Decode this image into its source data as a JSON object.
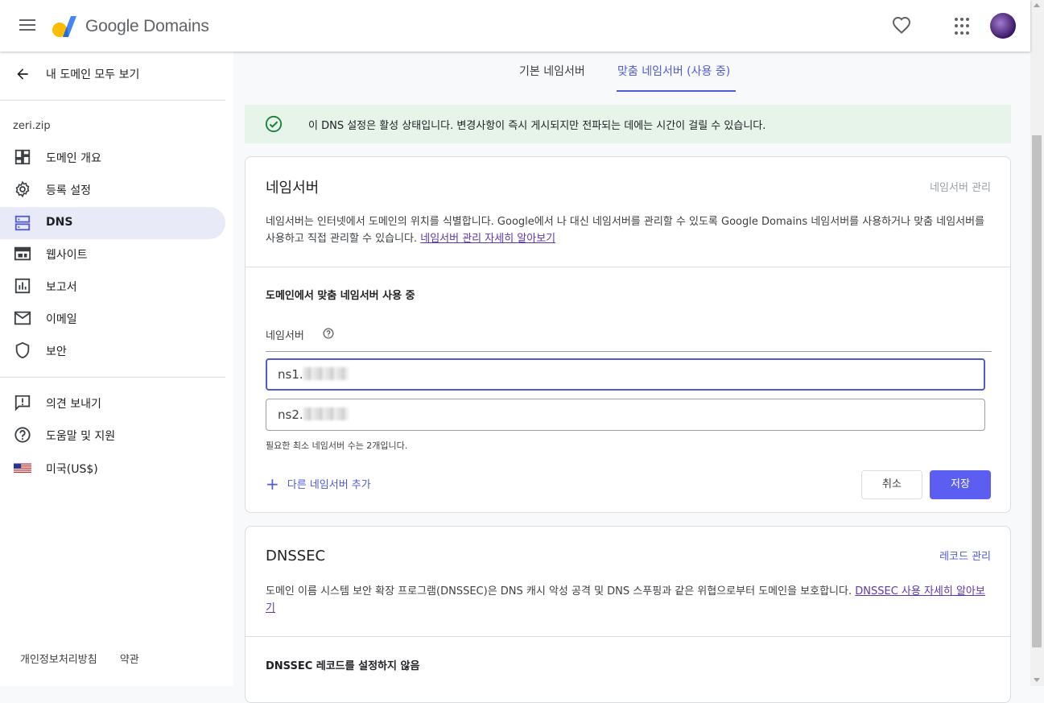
{
  "header": {
    "logo_text": "Google Domains",
    "icons": [
      "menu-icon",
      "heart-icon",
      "apps-icon",
      "avatar"
    ]
  },
  "sidebar": {
    "back_label": "내 도메인 모두 보기",
    "domain": "zeri.zip",
    "items": [
      {
        "label": "도메인 개요",
        "icon": "dashboard-icon"
      },
      {
        "label": "등록 설정",
        "icon": "gear-icon"
      },
      {
        "label": "DNS",
        "icon": "dns-icon",
        "active": true
      },
      {
        "label": "웹사이트",
        "icon": "website-icon"
      },
      {
        "label": "보고서",
        "icon": "chart-icon"
      },
      {
        "label": "이메일",
        "icon": "mail-icon"
      },
      {
        "label": "보안",
        "icon": "shield-icon"
      }
    ],
    "secondary_items": [
      {
        "label": "의견 보내기",
        "icon": "feedback-icon"
      },
      {
        "label": "도움말 및 지원",
        "icon": "help-icon"
      },
      {
        "label": "미국(US$)",
        "icon": "us-flag-icon"
      }
    ],
    "footer": {
      "privacy": "개인정보처리방침",
      "terms": "약관"
    }
  },
  "tabs": {
    "default": "기본 네임서버",
    "custom": "맞춤 네임서버 (사용 중)"
  },
  "banner": {
    "text": "이 DNS 설정은 활성 상태입니다. 변경사항이 즉시 게시되지만 전파되는 데에는 시간이 걸릴 수 있습니다."
  },
  "nameservers_card": {
    "title": "네임서버",
    "action": "네임서버 관리",
    "description": "네임서버는 인터넷에서 도메인의 위치를 식별합니다. Google에서 나 대신 네임서버를 관리할 수 있도록 Google Domains 네임서버를 사용하거나 맞춤 네임서버를 사용하고 직접 관리할 수 있습니다.",
    "learn_more": "네임서버 관리 자세히 알아보기",
    "subheading": "도메인에서 맞춤 네임서버 사용 중",
    "field_label": "네임서버",
    "ns1": "ns1.",
    "ns2": "ns2.",
    "hint": "필요한 최소 네임서버 수는 2개입니다.",
    "add_label": "다른 네임서버 추가",
    "cancel_label": "취소",
    "save_label": "저장"
  },
  "dnssec_card": {
    "title": "DNSSEC",
    "action": "레코드 관리",
    "description": "도메인 이름 시스템 보안 확장 프로그램(DNSSEC)은 DNS 캐시 악성 공격 및 DNS 스푸핑과 같은 위협으로부터 도메인을 보호합니다.",
    "learn_more": "DNSSEC 사용 자세히 알아보기",
    "status": "DNSSEC 레코드를 설정하지 않음"
  },
  "colors": {
    "accent": "#4f5bd5",
    "banner_bg": "#e6f4ea",
    "success": "#188038",
    "link": "#5e35b1"
  }
}
